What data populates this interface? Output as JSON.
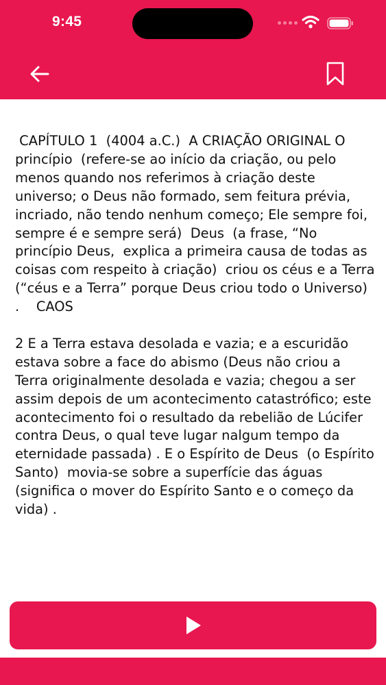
{
  "theme": {
    "accent": "#e8174f",
    "text": "#111111",
    "background": "#ffffff"
  },
  "status_bar": {
    "time": "9:45",
    "icons": [
      "signal-dots-icon",
      "wifi-icon",
      "battery-icon"
    ]
  },
  "header": {
    "back_icon": "arrow-left-icon",
    "bookmark_icon": "bookmark-icon"
  },
  "content": {
    "paragraphs": [
      " CAPÍTULO 1  (4004 a.C.)  A CRIAÇÃO ORIGINAL O princípio  (refere-se ao início da criação, ou pelo menos quando nos referimos à criação deste universo; o Deus não formado, sem feitura prévia, incriado, não tendo nenhum começo; Ele sempre foi, sempre é e sempre será)  Deus  (a frase, “No princípio Deus,  explica a primeira causa de todas as coisas com respeito à criação)  criou os céus e a Terra  (“céus e a Terra” porque Deus criou todo o Universo) .    CAOS",
      "2 E a Terra estava desolada e vazia; e a escuridão estava sobre a face do abismo (Deus não criou a Terra originalmente desolada e vazia; chegou a ser assim depois de um acontecimento catastrófico; este acontecimento foi o resultado da rebelião de Lúcifer contra Deus, o qual teve lugar nalgum tempo da eternidade passada) . E o Espírito de Deus  (o Espírito Santo)  movia-se sobre a superfície das águas  (significa o mover do Espírito Santo e o começo da vida) ."
    ]
  },
  "player": {
    "play_icon": "play-icon"
  }
}
